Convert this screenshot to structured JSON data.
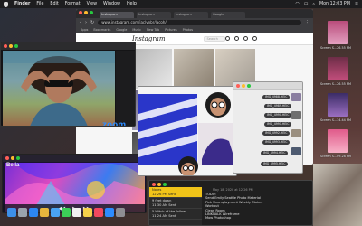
{
  "menubar": {
    "app_name": "Finder",
    "items": [
      "File",
      "Edit",
      "Format",
      "View",
      "Window",
      "Help"
    ],
    "right": [
      "Mon 12:03 PM"
    ]
  },
  "browser": {
    "tabs": [
      "Instagram",
      "Instagram",
      "Instagram",
      "Google"
    ],
    "url": "www.instagram.com/jaclynbr/lacoh/",
    "bookmarks": [
      "Apps",
      "Bookmarks",
      "Google",
      "Music",
      "New Tab",
      "Pictures",
      "Photos"
    ],
    "site_logo": "Instagram",
    "search_placeholder": "Search"
  },
  "zoom": {
    "brand": "zoom"
  },
  "artapp": {
    "title": "Bella",
    "controls": [
      "◀◀",
      "▶",
      "▶▶"
    ]
  },
  "chat": {
    "bubbles": [
      "IMG_4988.HEIC",
      "IMG_4989.HEIC",
      "IMG_4990.HEIC",
      "IMG_4991.HEIC",
      "IMG_4992.HEIC",
      "IMG_4993.HEIC",
      "IMG_4994.HEIC",
      "IMG_4995.HEIC"
    ]
  },
  "notes": {
    "list": [
      {
        "title": "Notes",
        "meta": "12:26 PM   Sent"
      },
      {
        "title": "9 feet down",
        "meta": "11:30 AM   Sent"
      },
      {
        "title": "5 Witch of the followi...",
        "meta": "11:24 AM   Sent"
      }
    ],
    "date": "May 18, 2020 at 12:26 PM",
    "body_lines": [
      "TODO:",
      "Send Emily Seattle Photo Material",
      "Pick Unemployment Weekly Claims",
      "Workout",
      "Clean Room",
      "LINKNALK Wireframe",
      "Mow Photoshop"
    ]
  },
  "desktop": {
    "labels": [
      "Screen S...26.55 PM",
      "Screen S...26.55 PM",
      "Screen S...34.44 PM",
      "Screen S...09.28 PM"
    ]
  }
}
